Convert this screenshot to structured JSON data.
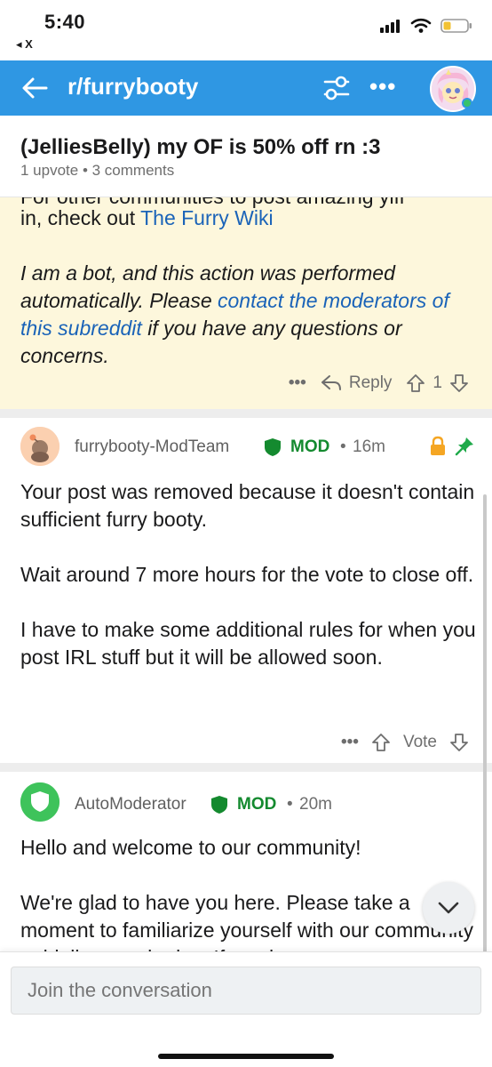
{
  "status_bar": {
    "time": "5:40",
    "back_label": "◂ X"
  },
  "app_bar": {
    "title": "r/furrybooty",
    "more": "•••"
  },
  "post": {
    "title": "(JelliesBelly) my OF is 50% off rn :3",
    "meta": "1 upvote • 3 comments"
  },
  "bot_comment": {
    "cut_line": "For other communities to post amazing yiff",
    "line1_prefix": "in, check out ",
    "line1_link": "The Furry Wiki",
    "italic_1": "I am a bot, and this action was performed automatically. Please ",
    "italic_link": "contact the moderators of this subreddit",
    "italic_2": " if you have any questions or concerns.",
    "more": "•••",
    "reply_label": "Reply",
    "vote_count": "1"
  },
  "comments": [
    {
      "author": "furrybooty-ModTeam",
      "badge": "MOD",
      "dot": "•",
      "time": "16m",
      "paragraphs": [
        "Your post was removed because it doesn't contain sufficient furry booty.",
        "Wait around 7 more hours for the vote to close off.",
        "I have to make some additional rules for when you post IRL stuff but it will be allowed soon."
      ],
      "more": "•••",
      "vote_label": "Vote"
    },
    {
      "author": "AutoModerator",
      "badge": "MOD",
      "dot": "•",
      "time": "20m",
      "paragraphs": [
        "Hello and welcome to our community!",
        "We're glad to have you here. Please take a moment to familiarize yourself with our community guidelines and rules. If you have"
      ]
    }
  ],
  "composer": {
    "placeholder": "Join the conversation"
  },
  "colors": {
    "app_bar": "#2f97e3",
    "bot_block": "#fdf7dc",
    "mod_green": "#148a2f",
    "link_blue": "#1a63b8",
    "pin_green": "#1faa4a",
    "lock_orange": "#f5a623"
  }
}
